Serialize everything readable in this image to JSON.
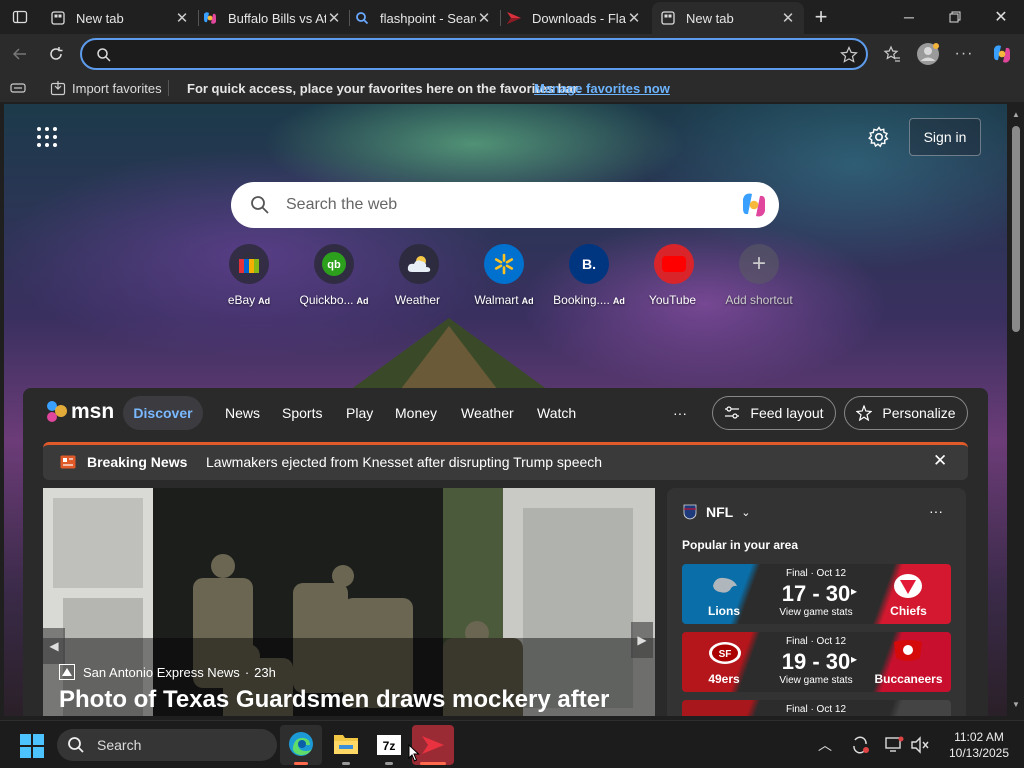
{
  "browser": {
    "tabs": [
      {
        "title": "New tab",
        "icon": "new-tab-icon"
      },
      {
        "title": "Buffalo Bills vs At",
        "icon": "copilot-icon"
      },
      {
        "title": "flashpoint - Searc",
        "icon": "bing-search-icon"
      },
      {
        "title": "Downloads - Flas",
        "icon": "flashpoint-icon"
      },
      {
        "title": "New tab",
        "icon": "new-tab-icon"
      }
    ],
    "address_value": "",
    "favorites_bar": {
      "import_label": "Import favorites",
      "hint": "For quick access, place your favorites here on the favorites bar.",
      "manage_link": "Manage favorites now"
    }
  },
  "newtab": {
    "sign_in": "Sign in",
    "search_placeholder": "Search the web",
    "shortcuts": [
      {
        "label": "eBay",
        "ad": "Ad"
      },
      {
        "label": "Quickbo...",
        "ad": "Ad"
      },
      {
        "label": "Weather",
        "ad": ""
      },
      {
        "label": "Walmart",
        "ad": "Ad"
      },
      {
        "label": "Booking....",
        "ad": "Ad"
      },
      {
        "label": "YouTube",
        "ad": ""
      },
      {
        "label": "Add shortcut",
        "ad": ""
      }
    ],
    "msn": {
      "logo_text": "msn",
      "nav": [
        "Discover",
        "News",
        "Sports",
        "Play",
        "Money",
        "Weather",
        "Watch"
      ],
      "more": "···",
      "feed_layout": "Feed layout",
      "personalize": "Personalize",
      "breaking": {
        "label": "Breaking News",
        "headline": "Lawmakers ejected from Knesset after disrupting Trump speech"
      },
      "feature": {
        "source": "San Antonio Express News",
        "age": "23h",
        "headline": "Photo of Texas Guardsmen draws mockery after"
      },
      "nfl": {
        "title": "NFL",
        "subtitle": "Popular in your area",
        "more": "···",
        "games": [
          {
            "status": "Final · Oct 12",
            "score": "17 - 30",
            "stats": "View game stats",
            "home": "Lions",
            "away": "Chiefs",
            "left_color": "#0a6ea8",
            "right_color": "#d4182f"
          },
          {
            "status": "Final · Oct 12",
            "score": "19 - 30",
            "stats": "View game stats",
            "home": "49ers",
            "away": "Buccaneers",
            "left_color": "#b5161c",
            "right_color": "#c8102e"
          },
          {
            "status": "Final · Oct 12",
            "score": "",
            "stats": "",
            "home": "",
            "away": "",
            "left_color": "#a8171c",
            "right_color": "#444444"
          }
        ]
      }
    }
  },
  "taskbar": {
    "search_label": "Search",
    "time": "11:02 AM",
    "date": "10/13/2025"
  }
}
